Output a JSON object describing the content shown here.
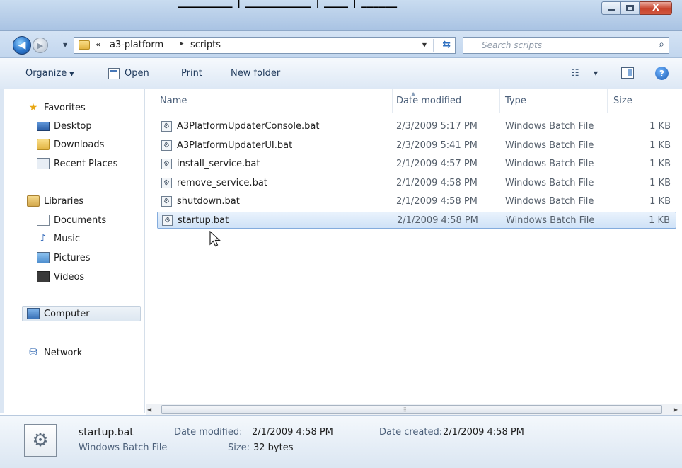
{
  "top_caption": "_________ | ___________ | ____ | ______",
  "window_controls": {
    "minimize": "minimize",
    "maximize": "maximize",
    "close": "X"
  },
  "address": {
    "overflow": "«",
    "crumbs": [
      "a3-platform",
      "scripts"
    ],
    "separator": "▸"
  },
  "search": {
    "placeholder": "Search scripts"
  },
  "toolbar": {
    "organize": "Organize",
    "open": "Open",
    "print": "Print",
    "new_folder": "New folder"
  },
  "nav": {
    "favorites": "Favorites",
    "desktop": "Desktop",
    "downloads": "Downloads",
    "recent_places": "Recent Places",
    "libraries": "Libraries",
    "documents": "Documents",
    "music": "Music",
    "pictures": "Pictures",
    "videos": "Videos",
    "computer": "Computer",
    "network": "Network"
  },
  "columns": {
    "name": "Name",
    "date_modified": "Date modified",
    "type": "Type",
    "size": "Size"
  },
  "files": [
    {
      "name": "A3PlatformUpdaterConsole.bat",
      "date": "2/3/2009 5:17 PM",
      "type": "Windows Batch File",
      "size": "1 KB"
    },
    {
      "name": "A3PlatformUpdaterUI.bat",
      "date": "2/3/2009 5:41 PM",
      "type": "Windows Batch File",
      "size": "1 KB"
    },
    {
      "name": "install_service.bat",
      "date": "2/1/2009 4:57 PM",
      "type": "Windows Batch File",
      "size": "1 KB"
    },
    {
      "name": "remove_service.bat",
      "date": "2/1/2009 4:58 PM",
      "type": "Windows Batch File",
      "size": "1 KB"
    },
    {
      "name": "shutdown.bat",
      "date": "2/1/2009 4:58 PM",
      "type": "Windows Batch File",
      "size": "1 KB"
    },
    {
      "name": "startup.bat",
      "date": "2/1/2009 4:58 PM",
      "type": "Windows Batch File",
      "size": "1 KB"
    }
  ],
  "selected_file_index": 5,
  "details": {
    "filename": "startup.bat",
    "filetype": "Windows Batch File",
    "date_modified_label": "Date modified:",
    "date_modified": "2/1/2009 4:58 PM",
    "size_label": "Size:",
    "size": "32 bytes",
    "date_created_label": "Date created:",
    "date_created": "2/1/2009 4:58 PM"
  },
  "colors": {
    "selection": "#cfe2f7",
    "selection_border": "#84acdd",
    "chrome": "#c2d6ee",
    "close": "#c8452e"
  },
  "icons": {
    "back": "back-arrow-icon",
    "forward": "forward-arrow-icon",
    "folder": "folder-icon",
    "refresh": "refresh-icon",
    "search": "search-icon",
    "views": "views-icon",
    "preview": "preview-pane-icon",
    "help": "help-icon",
    "batch_file": "batch-file-icon"
  }
}
